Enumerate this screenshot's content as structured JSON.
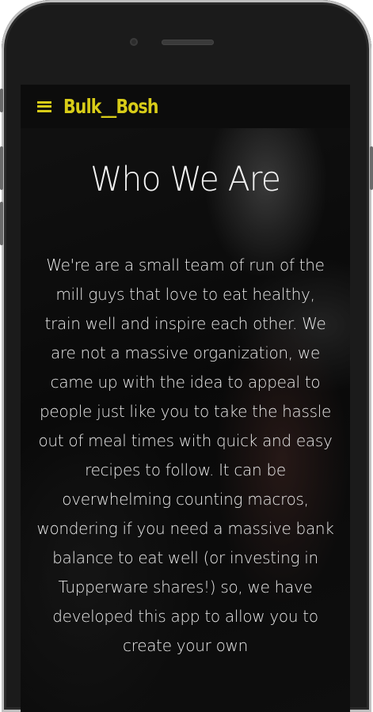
{
  "navbar": {
    "brand": "Bulk__Bosh",
    "menu_icon": "hamburger-menu-icon",
    "accent_color": "#d8cc18",
    "background_color": "#0c0c0c"
  },
  "about": {
    "title": "Who We Are",
    "paragraph": "We're are a small team of run of the mill guys that love to eat healthy, train well and inspire each other. We are not a massive organization, we came up with the idea to appeal to people just like you to take the hassle out of meal times with quick and easy recipes to follow. It can be overwhelming counting macros, wondering if you need a massive bank balance to eat well (or investing in Tupperware shares!) so, we have developed this app to allow you to create your own"
  }
}
